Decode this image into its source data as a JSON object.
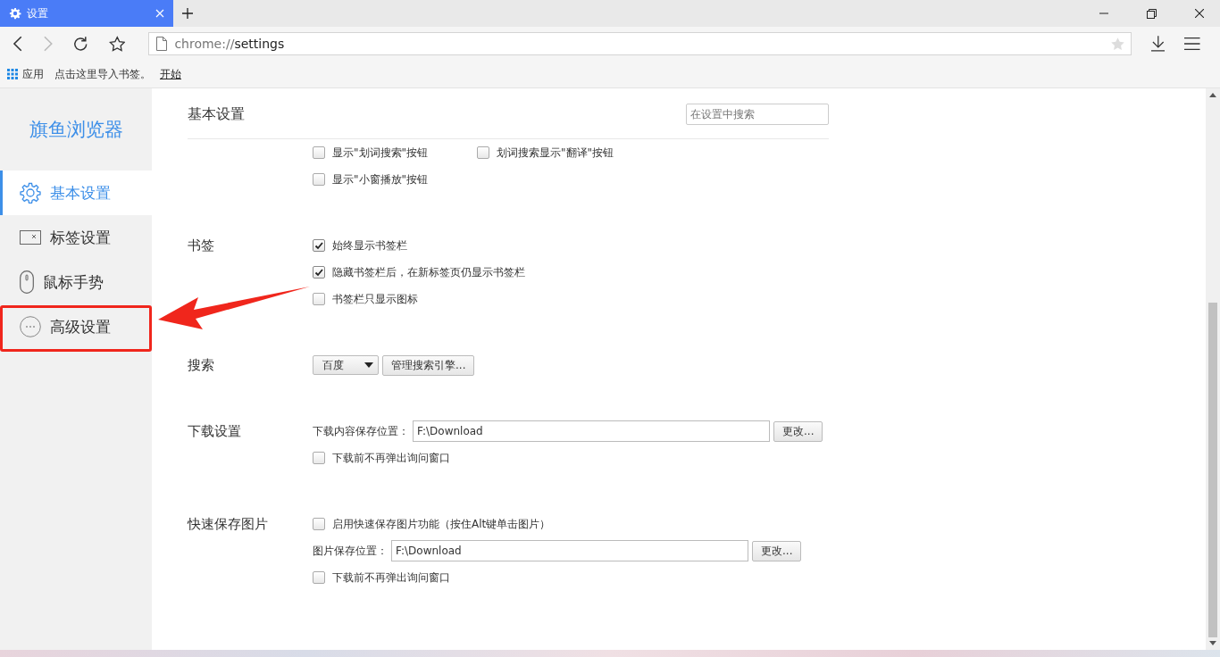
{
  "tab": {
    "title": "设置",
    "selected": true
  },
  "address": {
    "url_scheme": "chrome://",
    "url_path": "settings"
  },
  "bookmarks_bar": {
    "apps": "应用",
    "hint": "点击这里导入书签。",
    "link": "开始"
  },
  "sidebar": {
    "brand": "旗鱼浏览器",
    "items": [
      {
        "label": "基本设置",
        "kind": "gear",
        "selected": true,
        "highlighted": false
      },
      {
        "label": "标签设置",
        "kind": "tab",
        "selected": false,
        "highlighted": false
      },
      {
        "label": "鼠标手势",
        "kind": "mouse",
        "selected": false,
        "highlighted": false
      },
      {
        "label": "高级设置",
        "kind": "dots",
        "selected": false,
        "highlighted": true
      }
    ]
  },
  "header": {
    "title": "基本设置",
    "search_placeholder": "在设置中搜索"
  },
  "sections": [
    {
      "rows": [
        {
          "kind": "checkbox",
          "items": [
            {
              "label": "显示\"划词搜索\"按钮",
              "checked": false
            },
            {
              "label": "划词搜索显示\"翻译\"按钮",
              "checked": false
            }
          ]
        },
        {
          "kind": "checkbox",
          "items": [
            {
              "label": "显示\"小窗播放\"按钮",
              "checked": false
            }
          ]
        }
      ]
    },
    {
      "title": "书签",
      "rows": [
        {
          "kind": "checkbox",
          "items": [
            {
              "label": "始终显示书签栏",
              "checked": true
            }
          ]
        },
        {
          "kind": "checkbox",
          "items": [
            {
              "label": "隐藏书签栏后，在新标签页仍显示书签栏",
              "checked": true
            }
          ]
        },
        {
          "kind": "checkbox",
          "items": [
            {
              "label": "书签栏只显示图标",
              "checked": false
            }
          ]
        }
      ]
    },
    {
      "title": "搜索",
      "rows": [
        {
          "kind": "select",
          "value": "百度",
          "button": "管理搜索引擎..."
        }
      ]
    },
    {
      "title": "下载设置",
      "rows": [
        {
          "kind": "path",
          "label": "下载内容保存位置：",
          "value": "F:\\Download",
          "button": "更改..."
        },
        {
          "kind": "checkbox",
          "items": [
            {
              "label": "下载前不再弹出询问窗口",
              "checked": false
            }
          ]
        }
      ]
    },
    {
      "title": "快速保存图片",
      "rows": [
        {
          "kind": "checkbox",
          "items": [
            {
              "label": "启用快速保存图片功能（按住Alt键单击图片）",
              "checked": false
            }
          ]
        },
        {
          "kind": "path",
          "label": "图片保存位置：",
          "value": "F:\\Download",
          "button": "更改..."
        },
        {
          "kind": "checkbox",
          "items": [
            {
              "label": "下载前不再弹出询问窗口",
              "checked": false
            }
          ]
        }
      ]
    }
  ]
}
